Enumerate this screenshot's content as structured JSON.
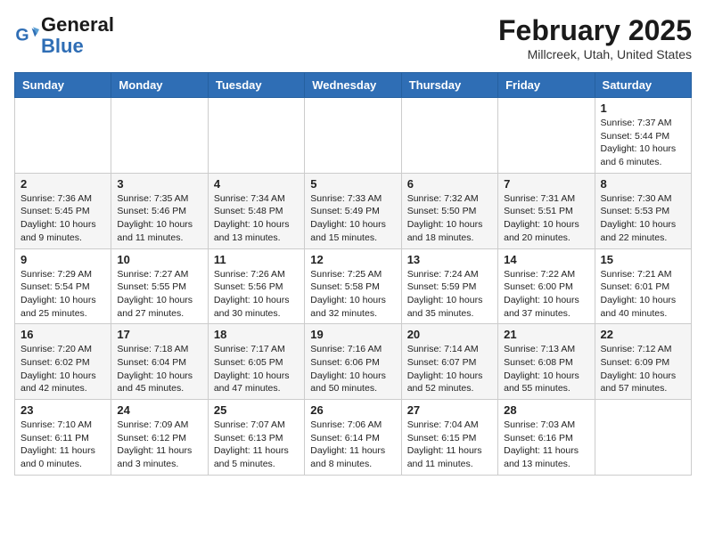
{
  "header": {
    "logo_line1": "General",
    "logo_line2": "Blue",
    "month": "February 2025",
    "location": "Millcreek, Utah, United States"
  },
  "days_of_week": [
    "Sunday",
    "Monday",
    "Tuesday",
    "Wednesday",
    "Thursday",
    "Friday",
    "Saturday"
  ],
  "weeks": [
    [
      {
        "day": "",
        "info": ""
      },
      {
        "day": "",
        "info": ""
      },
      {
        "day": "",
        "info": ""
      },
      {
        "day": "",
        "info": ""
      },
      {
        "day": "",
        "info": ""
      },
      {
        "day": "",
        "info": ""
      },
      {
        "day": "1",
        "info": "Sunrise: 7:37 AM\nSunset: 5:44 PM\nDaylight: 10 hours and 6 minutes."
      }
    ],
    [
      {
        "day": "2",
        "info": "Sunrise: 7:36 AM\nSunset: 5:45 PM\nDaylight: 10 hours and 9 minutes."
      },
      {
        "day": "3",
        "info": "Sunrise: 7:35 AM\nSunset: 5:46 PM\nDaylight: 10 hours and 11 minutes."
      },
      {
        "day": "4",
        "info": "Sunrise: 7:34 AM\nSunset: 5:48 PM\nDaylight: 10 hours and 13 minutes."
      },
      {
        "day": "5",
        "info": "Sunrise: 7:33 AM\nSunset: 5:49 PM\nDaylight: 10 hours and 15 minutes."
      },
      {
        "day": "6",
        "info": "Sunrise: 7:32 AM\nSunset: 5:50 PM\nDaylight: 10 hours and 18 minutes."
      },
      {
        "day": "7",
        "info": "Sunrise: 7:31 AM\nSunset: 5:51 PM\nDaylight: 10 hours and 20 minutes."
      },
      {
        "day": "8",
        "info": "Sunrise: 7:30 AM\nSunset: 5:53 PM\nDaylight: 10 hours and 22 minutes."
      }
    ],
    [
      {
        "day": "9",
        "info": "Sunrise: 7:29 AM\nSunset: 5:54 PM\nDaylight: 10 hours and 25 minutes."
      },
      {
        "day": "10",
        "info": "Sunrise: 7:27 AM\nSunset: 5:55 PM\nDaylight: 10 hours and 27 minutes."
      },
      {
        "day": "11",
        "info": "Sunrise: 7:26 AM\nSunset: 5:56 PM\nDaylight: 10 hours and 30 minutes."
      },
      {
        "day": "12",
        "info": "Sunrise: 7:25 AM\nSunset: 5:58 PM\nDaylight: 10 hours and 32 minutes."
      },
      {
        "day": "13",
        "info": "Sunrise: 7:24 AM\nSunset: 5:59 PM\nDaylight: 10 hours and 35 minutes."
      },
      {
        "day": "14",
        "info": "Sunrise: 7:22 AM\nSunset: 6:00 PM\nDaylight: 10 hours and 37 minutes."
      },
      {
        "day": "15",
        "info": "Sunrise: 7:21 AM\nSunset: 6:01 PM\nDaylight: 10 hours and 40 minutes."
      }
    ],
    [
      {
        "day": "16",
        "info": "Sunrise: 7:20 AM\nSunset: 6:02 PM\nDaylight: 10 hours and 42 minutes."
      },
      {
        "day": "17",
        "info": "Sunrise: 7:18 AM\nSunset: 6:04 PM\nDaylight: 10 hours and 45 minutes."
      },
      {
        "day": "18",
        "info": "Sunrise: 7:17 AM\nSunset: 6:05 PM\nDaylight: 10 hours and 47 minutes."
      },
      {
        "day": "19",
        "info": "Sunrise: 7:16 AM\nSunset: 6:06 PM\nDaylight: 10 hours and 50 minutes."
      },
      {
        "day": "20",
        "info": "Sunrise: 7:14 AM\nSunset: 6:07 PM\nDaylight: 10 hours and 52 minutes."
      },
      {
        "day": "21",
        "info": "Sunrise: 7:13 AM\nSunset: 6:08 PM\nDaylight: 10 hours and 55 minutes."
      },
      {
        "day": "22",
        "info": "Sunrise: 7:12 AM\nSunset: 6:09 PM\nDaylight: 10 hours and 57 minutes."
      }
    ],
    [
      {
        "day": "23",
        "info": "Sunrise: 7:10 AM\nSunset: 6:11 PM\nDaylight: 11 hours and 0 minutes."
      },
      {
        "day": "24",
        "info": "Sunrise: 7:09 AM\nSunset: 6:12 PM\nDaylight: 11 hours and 3 minutes."
      },
      {
        "day": "25",
        "info": "Sunrise: 7:07 AM\nSunset: 6:13 PM\nDaylight: 11 hours and 5 minutes."
      },
      {
        "day": "26",
        "info": "Sunrise: 7:06 AM\nSunset: 6:14 PM\nDaylight: 11 hours and 8 minutes."
      },
      {
        "day": "27",
        "info": "Sunrise: 7:04 AM\nSunset: 6:15 PM\nDaylight: 11 hours and 11 minutes."
      },
      {
        "day": "28",
        "info": "Sunrise: 7:03 AM\nSunset: 6:16 PM\nDaylight: 11 hours and 13 minutes."
      },
      {
        "day": "",
        "info": ""
      }
    ]
  ]
}
